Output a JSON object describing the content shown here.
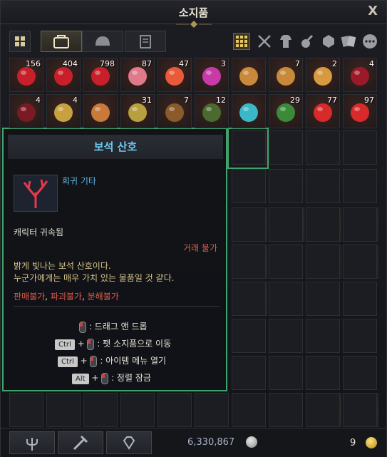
{
  "window": {
    "title": "소지품",
    "close_label": "X"
  },
  "tabs": [
    "grid-view-icon",
    "bag-icon",
    "helmet-icon",
    "book-icon"
  ],
  "filters": [
    "all-grid-icon",
    "crossed-swords-icon",
    "armor-icon",
    "potion-icon",
    "gem-icon",
    "cards-icon",
    "more-icon"
  ],
  "row1": [
    {
      "icon": "red-gem-icon",
      "count": "156"
    },
    {
      "icon": "red-gem-icon",
      "count": "404"
    },
    {
      "icon": "red-gem-icon",
      "count": "798"
    },
    {
      "icon": "pink-potion-icon",
      "count": "87"
    },
    {
      "icon": "fire-potion-icon",
      "count": "47"
    },
    {
      "icon": "magenta-potion-icon",
      "count": "3"
    },
    {
      "icon": "beer-mug-icon",
      "count": ""
    },
    {
      "icon": "beer-mug-icon",
      "count": "7"
    },
    {
      "icon": "beer-glass-icon",
      "count": "2"
    },
    {
      "icon": "wine-glass-icon",
      "count": "4"
    }
  ],
  "row2": [
    {
      "icon": "wine-bottle-icon",
      "count": "4"
    },
    {
      "icon": "food-plate-icon",
      "count": "4"
    },
    {
      "icon": "vase-icon",
      "count": ""
    },
    {
      "icon": "ore-icon",
      "count": "31"
    },
    {
      "icon": "treasure-chest-icon",
      "count": "7"
    },
    {
      "icon": "backpack-icon",
      "count": "12"
    },
    {
      "icon": "globe-icon",
      "count": ""
    },
    {
      "icon": "green-bottle-icon",
      "count": "29"
    },
    {
      "icon": "red-flask-icon",
      "count": "77"
    },
    {
      "icon": "red-flask-icon",
      "count": "97"
    }
  ],
  "tooltip": {
    "name": "보석 산호",
    "grade": "희귀 기타",
    "bound": "캐릭터 귀속됨",
    "trade": "거래 불가",
    "desc1": "밝게 빛나는 보석 산호이다.",
    "desc2": "누군가에게는 매우 가치 있는 물품일 것 같다.",
    "flag1": "판매불가",
    "flag2": "파괴불가",
    "flag3": "분해불가",
    "hint1": ": 드래그 앤 드롭",
    "hint2": ": 펫 소지품으로 이동",
    "hint3": ": 아이템 메뉴 열기",
    "hint4": ": 정렬 잠금",
    "key_ctrl": "Ctrl",
    "key_alt": "Alt"
  },
  "footer": {
    "money": "6,330,867",
    "coins": "9"
  }
}
